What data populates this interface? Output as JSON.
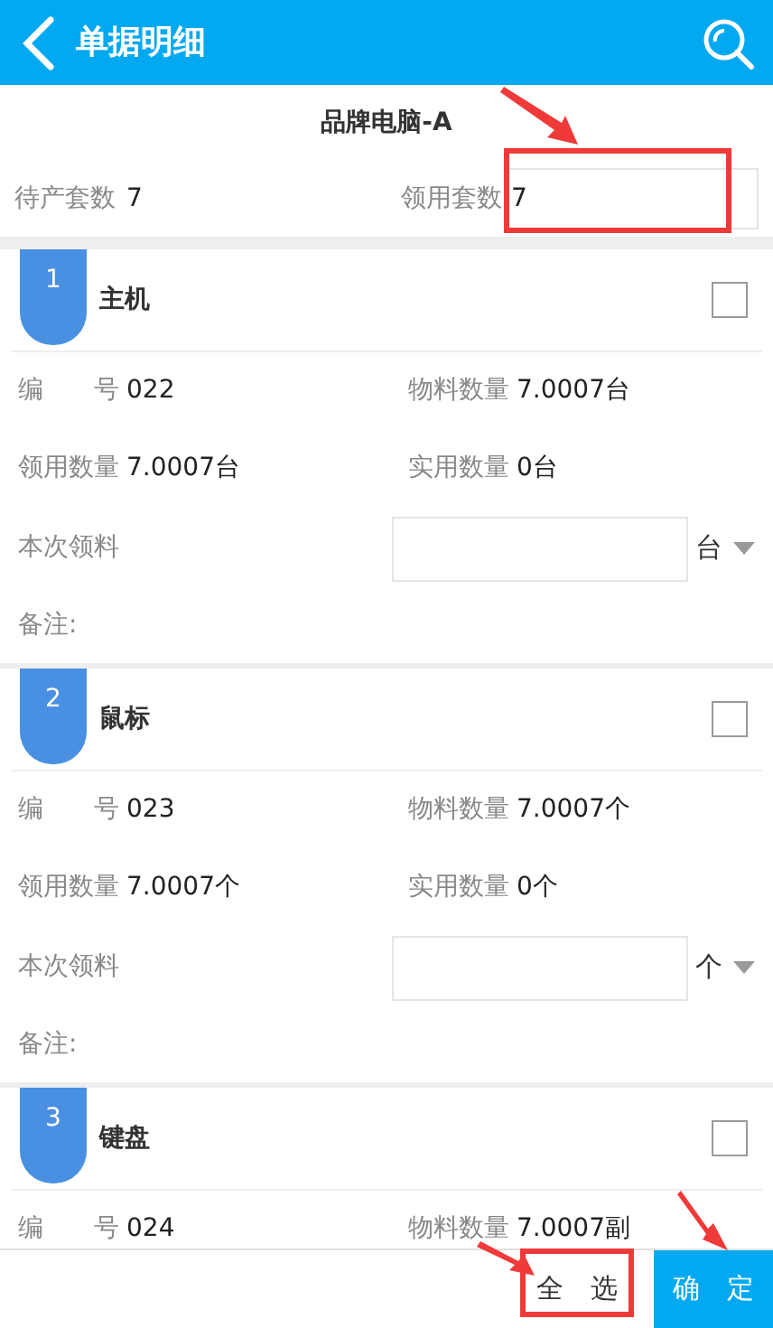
{
  "header": {
    "title": "单据明细"
  },
  "product": {
    "title": "品牌电脑-A",
    "pending_label": "待产套数",
    "pending_value": "7",
    "issue_label": "领用套数",
    "issue_value": "7"
  },
  "items": [
    {
      "index": "1",
      "name": "主机",
      "checked": false,
      "fields": [
        {
          "label": "编　　号",
          "value": "022"
        },
        {
          "label": "物料数量",
          "value": "7.0007台"
        },
        {
          "label": "领用数量",
          "value": "7.0007台"
        },
        {
          "label": "实用数量",
          "value": "0台"
        }
      ],
      "issue": {
        "label": "本次领料",
        "unit": "台"
      },
      "note_label": "备注:"
    },
    {
      "index": "2",
      "name": "鼠标",
      "checked": false,
      "fields": [
        {
          "label": "编　　号",
          "value": "023"
        },
        {
          "label": "物料数量",
          "value": "7.0007个"
        },
        {
          "label": "领用数量",
          "value": "7.0007个"
        },
        {
          "label": "实用数量",
          "value": "0个"
        }
      ],
      "issue": {
        "label": "本次领料",
        "unit": "个"
      },
      "note_label": "备注:"
    },
    {
      "index": "3",
      "name": "键盘",
      "checked": false,
      "fields": [
        {
          "label": "编　　号",
          "value": "024"
        },
        {
          "label": "物料数量",
          "value": "7.0007副"
        }
      ]
    }
  ],
  "footer": {
    "select_all": "全　选",
    "confirm": "确　定"
  }
}
